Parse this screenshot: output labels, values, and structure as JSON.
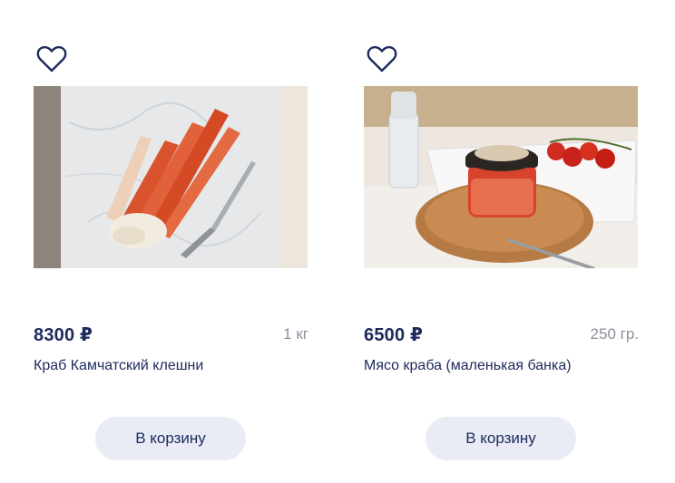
{
  "products": [
    {
      "price": "8300 ₽",
      "weight": "1 кг",
      "title": "Краб Камчатский клешни",
      "button_label": "В корзину",
      "favorite_icon": "heart-outline-icon",
      "image": "crab-legs-photo"
    },
    {
      "price": "6500 ₽",
      "weight": "250 гр.",
      "title": "Мясо краба (маленькая банка)",
      "button_label": "В корзину",
      "favorite_icon": "heart-outline-icon",
      "image": "crab-meat-jar-photo"
    }
  ],
  "colors": {
    "text_primary": "#1d2a5c",
    "text_muted": "#8a8f9c",
    "button_bg": "#e9ecf5"
  }
}
